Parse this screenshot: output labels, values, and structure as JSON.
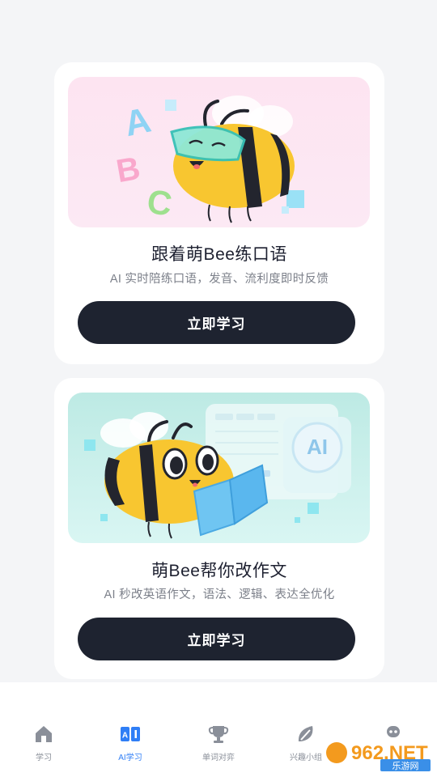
{
  "cards": [
    {
      "title": "跟着萌Bee练口语",
      "subtitle": "AI 实时陪练口语，发音、流利度即时反馈",
      "button": "立即学习"
    },
    {
      "title": "萌Bee帮你改作文",
      "subtitle": "AI 秒改英语作文，语法、逻辑、表达全优化",
      "button": "立即学习"
    }
  ],
  "illustration_text": {
    "abc": "ABC",
    "ai_badge": "AI"
  },
  "tabbar": {
    "items": [
      {
        "label": "学习",
        "icon": "home-icon",
        "active": false
      },
      {
        "label": "AI学习",
        "icon": "ai-book-icon",
        "active": true
      },
      {
        "label": "单词对弈",
        "icon": "trophy-icon",
        "active": false
      },
      {
        "label": "兴趣小组",
        "icon": "leaf-icon",
        "active": false
      },
      {
        "label": "",
        "icon": "profile-icon",
        "active": false
      }
    ]
  },
  "watermark": {
    "text": "962.NET",
    "sub": "乐游网"
  },
  "colors": {
    "accent": "#2f7ef6",
    "button_bg": "#1e2330",
    "bee_yellow": "#f8c630",
    "bee_dark": "#23252e",
    "page_bg": "#f4f5f7"
  }
}
